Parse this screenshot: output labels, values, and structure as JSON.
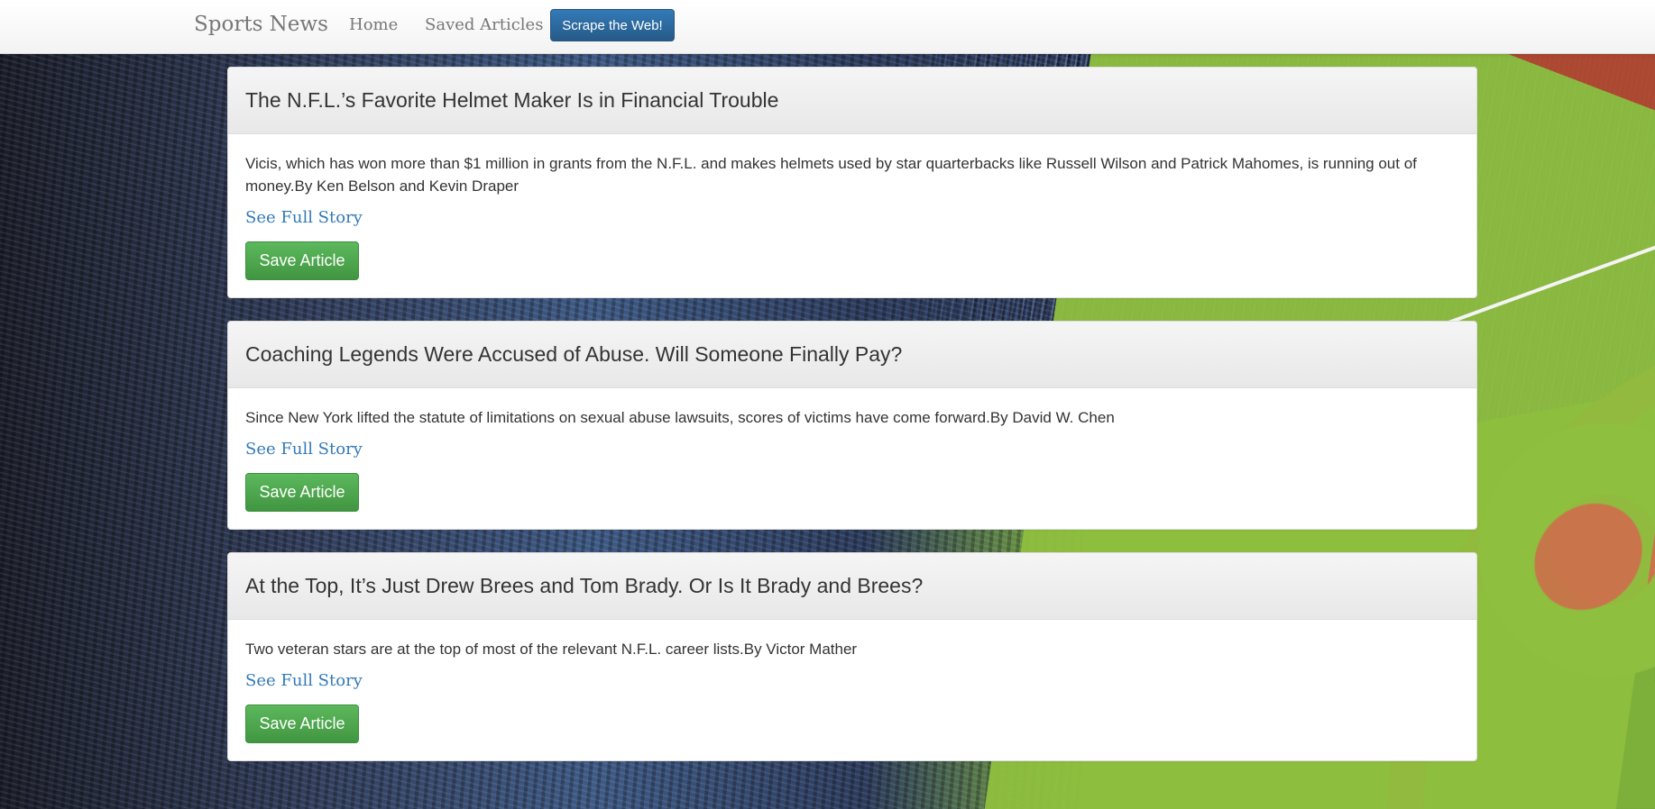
{
  "navbar": {
    "brand": "Sports News",
    "home_label": "Home",
    "saved_label": "Saved Articles",
    "scrape_label": "Scrape the Web!"
  },
  "articles": [
    {
      "title": "The N.F.L.’s Favorite Helmet Maker Is in Financial Trouble",
      "summary": "Vicis, which has won more than $1 million in grants from the N.F.L. and makes helmets used by star quarterbacks like Russell Wilson and Patrick Mahomes, is running out of money.By Ken Belson and Kevin Draper",
      "link_label": "See Full Story",
      "save_label": "Save Article"
    },
    {
      "title": "Coaching Legends Were Accused of Abuse. Will Someone Finally Pay?",
      "summary": "Since New York lifted the statute of limitations on sexual abuse lawsuits, scores of victims have come forward.By David W. Chen",
      "link_label": "See Full Story",
      "save_label": "Save Article"
    },
    {
      "title": "At the Top, It’s Just Drew Brees and Tom Brady. Or Is It Brady and Brees?",
      "summary": "Two veteran stars are at the top of most of the relevant N.F.L. career lists.By Victor Mather",
      "link_label": "See Full Story",
      "save_label": "Save Article"
    }
  ],
  "colors": {
    "primary": "#337ab7",
    "success": "#5cb85c"
  }
}
